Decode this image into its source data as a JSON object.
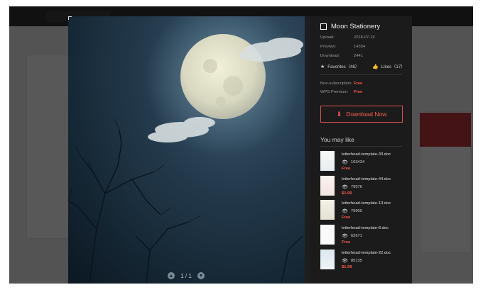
{
  "title": "Moon Stationery",
  "meta": {
    "upload_label": "Upload:",
    "upload_value": "2018-07-19",
    "preview_label": "Preview:",
    "preview_value": "14334",
    "download_label": "Download:",
    "download_value": "2441"
  },
  "stats": {
    "favorites": "Favorites（48）",
    "likes": "Likes（17）"
  },
  "pricing": {
    "nonsub_label": "Non-subscription:",
    "nonsub_value": "Free",
    "premium_label": "WPS Premium:",
    "premium_value": "Free"
  },
  "download_button": "Download Now",
  "pager": "1 / 1",
  "may_like_title": "You may like",
  "may_like": [
    {
      "name": "letterhead-template-33.doc",
      "views": "103434",
      "price": "Free"
    },
    {
      "name": "letterhead-template-44.doc",
      "views": "79576",
      "price": "$1.99"
    },
    {
      "name": "letterhead-template-13.doc",
      "views": "79900",
      "price": "Free"
    },
    {
      "name": "letterhead-template-8.doc",
      "views": "62671",
      "price": "Free"
    },
    {
      "name": "letterhead-template-22.doc",
      "views": "85135",
      "price": "$1.99"
    }
  ],
  "colors": {
    "accent": "#ff5f4f",
    "panel": "#1b1b1b",
    "overlay": "rgba(0,0,0,0.62)"
  },
  "icons": [
    "logo-icon",
    "star-icon",
    "thumb-up-icon",
    "download-icon",
    "eye-icon",
    "arrow-up-icon",
    "arrow-down-icon"
  ]
}
